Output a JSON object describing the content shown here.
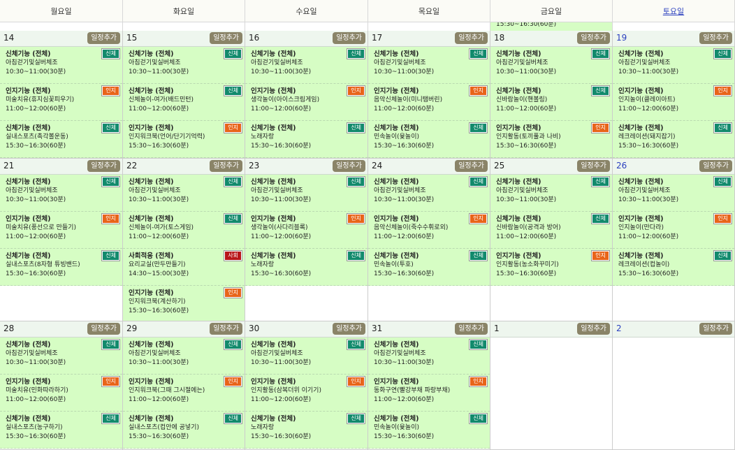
{
  "weekdays": [
    "월요일",
    "화요일",
    "수요일",
    "목요일",
    "금요일",
    "토요일"
  ],
  "add_label": "일정추가",
  "prev_fri_tail": "15:30~16:30(60분)",
  "weeks": [
    {
      "days": [
        {
          "num": "14",
          "events": [
            {
              "t": "신체기능 (전체)",
              "tag": "신체",
              "d": "아침걷기및실버체조",
              "tm": "10:30~11:00(30분)"
            },
            {
              "t": "인지기능 (전체)",
              "tag": "인지",
              "d": "미술치유(휴지심꽃피우기)",
              "tm": "11:00~12:00(60분)"
            },
            {
              "t": "신체기능 (전체)",
              "tag": "신체",
              "d": "실내스포츠(촉각볼운동)",
              "tm": "15:30~16:30(60분)"
            }
          ]
        },
        {
          "num": "15",
          "events": [
            {
              "t": "신체기능 (전체)",
              "tag": "신체",
              "d": "아침걷기및실버체조",
              "tm": "10:30~11:00(30분)"
            },
            {
              "t": "신체기능 (전체)",
              "tag": "신체",
              "d": "신체놀이-여가(배드민턴)",
              "tm": "11:00~12:00(60분)"
            },
            {
              "t": "인지기능 (전체)",
              "tag": "인지",
              "d": "인지워크북(언어/단기기억력)",
              "tm": "15:30~16:30(60분)"
            }
          ]
        },
        {
          "num": "16",
          "events": [
            {
              "t": "신체기능 (전체)",
              "tag": "신체",
              "d": "아침걷기및실버체조",
              "tm": "10:30~11:00(30분)"
            },
            {
              "t": "인지기능 (전체)",
              "tag": "인지",
              "d": "생각놀이(아이스크림게임)",
              "tm": "11:00~12:00(60분)"
            },
            {
              "t": "신체기능 (전체)",
              "tag": "신체",
              "d": "노래자랑",
              "tm": "15:30~16:30(60분)"
            }
          ]
        },
        {
          "num": "17",
          "events": [
            {
              "t": "신체기능 (전체)",
              "tag": "신체",
              "d": "아침걷기및실버체조",
              "tm": "10:30~11:00(30분)"
            },
            {
              "t": "인지기능 (전체)",
              "tag": "인지",
              "d": "음악신체놀이(미니탬버린)",
              "tm": "11:00~12:00(60분)"
            },
            {
              "t": "신체기능 (전체)",
              "tag": "신체",
              "d": "민속놀이(윷놀이)",
              "tm": "15:30~16:30(60분)"
            }
          ]
        },
        {
          "num": "18",
          "events": [
            {
              "t": "신체기능 (전체)",
              "tag": "신체",
              "d": "아침걷기및실버체조",
              "tm": "10:30~11:00(30분)"
            },
            {
              "t": "신체기능 (전체)",
              "tag": "신체",
              "d": "신바람놀이(핸볼링)",
              "tm": "11:00~12:00(60분)"
            },
            {
              "t": "인지기능 (전체)",
              "tag": "인지",
              "d": "인지활동(토끼풀과 나비)",
              "tm": "15:30~16:30(60분)"
            }
          ]
        },
        {
          "num": "19",
          "events": [
            {
              "t": "신체기능 (전체)",
              "tag": "신체",
              "d": "아침걷기및실버체조",
              "tm": "10:30~11:00(30분)"
            },
            {
              "t": "인지기능 (전체)",
              "tag": "인지",
              "d": "인지놀이(클레이아트)",
              "tm": "11:00~12:00(60분)"
            },
            {
              "t": "신체기능 (전체)",
              "tag": "신체",
              "d": "레크레이션(돼지잡기)",
              "tm": "15:30~16:30(60분)"
            }
          ]
        }
      ]
    },
    {
      "days": [
        {
          "num": "21",
          "events": [
            {
              "t": "신체기능 (전체)",
              "tag": "신체",
              "d": "아침걷기및실버체조",
              "tm": "10:30~11:00(30분)"
            },
            {
              "t": "인지기능 (전체)",
              "tag": "인지",
              "d": "미술치유(풍선으로 만들기)",
              "tm": "11:00~12:00(60분)"
            },
            {
              "t": "신체기능 (전체)",
              "tag": "신체",
              "d": "실내스포츠(8자형 튜빙밴드)",
              "tm": "15:30~16:30(60분)"
            }
          ]
        },
        {
          "num": "22",
          "events": [
            {
              "t": "신체기능 (전체)",
              "tag": "신체",
              "d": "아침걷기및실버체조",
              "tm": "10:30~11:00(30분)"
            },
            {
              "t": "신체기능 (전체)",
              "tag": "신체",
              "d": "신체놀이-여가(토스게임)",
              "tm": "11:00~12:00(60분)"
            },
            {
              "t": "사회적응 (전체)",
              "tag": "사회",
              "d": "요리교실(만두만들기)",
              "tm": "14:30~15:00(30분)"
            },
            {
              "t": "인지기능 (전체)",
              "tag": "인지",
              "d": "인지워크북(계산하기)",
              "tm": "15:30~16:30(60분)"
            }
          ]
        },
        {
          "num": "23",
          "events": [
            {
              "t": "신체기능 (전체)",
              "tag": "신체",
              "d": "아침걷기및실버체조",
              "tm": "10:30~11:00(30분)"
            },
            {
              "t": "인지기능 (전체)",
              "tag": "인지",
              "d": "생각놀이(사다리블록)",
              "tm": "11:00~12:00(60분)"
            },
            {
              "t": "신체기능 (전체)",
              "tag": "신체",
              "d": "노래자랑",
              "tm": "15:30~16:30(60분)"
            }
          ]
        },
        {
          "num": "24",
          "events": [
            {
              "t": "신체기능 (전체)",
              "tag": "신체",
              "d": "아침걷기및실버체조",
              "tm": "10:30~11:00(30분)"
            },
            {
              "t": "인지기능 (전체)",
              "tag": "인지",
              "d": "음악신체놀이(죽수수휘로외)",
              "tm": "11:00~12:00(60분)"
            },
            {
              "t": "신체기능 (전체)",
              "tag": "신체",
              "d": "민속놀이(투호)",
              "tm": "15:30~16:30(60분)"
            }
          ]
        },
        {
          "num": "25",
          "events": [
            {
              "t": "신체기능 (전체)",
              "tag": "신체",
              "d": "아침걷기및실버체조",
              "tm": "10:30~11:00(30분)"
            },
            {
              "t": "신체기능 (전체)",
              "tag": "신체",
              "d": "신바람놀이(공격과 방어)",
              "tm": "11:00~12:00(60분)"
            },
            {
              "t": "인지기능 (전체)",
              "tag": "인지",
              "d": "인지활동(농소화꾸미기)",
              "tm": "15:30~16:30(60분)"
            }
          ]
        },
        {
          "num": "26",
          "events": [
            {
              "t": "신체기능 (전체)",
              "tag": "신체",
              "d": "아침걷기및실버체조",
              "tm": "10:30~11:00(30분)"
            },
            {
              "t": "인지기능 (전체)",
              "tag": "인지",
              "d": "인지놀이(만다라)",
              "tm": "11:00~12:00(60분)"
            },
            {
              "t": "신체기능 (전체)",
              "tag": "신체",
              "d": "레크레이션(컵놀이)",
              "tm": "15:30~16:30(60분)"
            }
          ]
        }
      ]
    },
    {
      "days": [
        {
          "num": "28",
          "events": [
            {
              "t": "신체기능 (전체)",
              "tag": "신체",
              "d": "아침걷기및실버체조",
              "tm": "10:30~11:00(30분)"
            },
            {
              "t": "인지기능 (전체)",
              "tag": "인지",
              "d": "미술치유(민화따라하기)",
              "tm": "11:00~12:00(60분)"
            },
            {
              "t": "신체기능 (전체)",
              "tag": "신체",
              "d": "실내스포츠(농구하기)",
              "tm": "15:30~16:30(60분)"
            }
          ]
        },
        {
          "num": "29",
          "events": [
            {
              "t": "신체기능 (전체)",
              "tag": "신체",
              "d": "아침걷기및실버체조",
              "tm": "10:30~11:00(30분)"
            },
            {
              "t": "인지기능 (전체)",
              "tag": "인지",
              "d": "인지워크북(그때 그시절에는)",
              "tm": "11:00~12:00(60분)"
            },
            {
              "t": "신체기능 (전체)",
              "tag": "신체",
              "d": "실내스포츠(컵안에 공넣기)",
              "tm": "15:30~16:30(60분)"
            }
          ]
        },
        {
          "num": "30",
          "events": [
            {
              "t": "신체기능 (전체)",
              "tag": "신체",
              "d": "아침걷기및실버체조",
              "tm": "10:30~11:00(30분)"
            },
            {
              "t": "인지기능 (전체)",
              "tag": "인지",
              "d": "인지활동(삼복더위 이기기)",
              "tm": "11:00~12:00(60분)"
            },
            {
              "t": "신체기능 (전체)",
              "tag": "신체",
              "d": "노래자랑",
              "tm": "15:30~16:30(60분)"
            }
          ]
        },
        {
          "num": "31",
          "events": [
            {
              "t": "신체기능 (전체)",
              "tag": "신체",
              "d": "아침걷기및실버체조",
              "tm": "10:30~11:00(30분)"
            },
            {
              "t": "인지기능 (전체)",
              "tag": "인지",
              "d": "동화구연(빨강부채 파랑부채)",
              "tm": "11:00~12:00(60분)"
            },
            {
              "t": "신체기능 (전체)",
              "tag": "신체",
              "d": "민속놀이(윷놀이)",
              "tm": "15:30~16:30(60분)"
            }
          ]
        },
        {
          "num": "1",
          "events": []
        },
        {
          "num": "2",
          "events": []
        }
      ]
    }
  ]
}
